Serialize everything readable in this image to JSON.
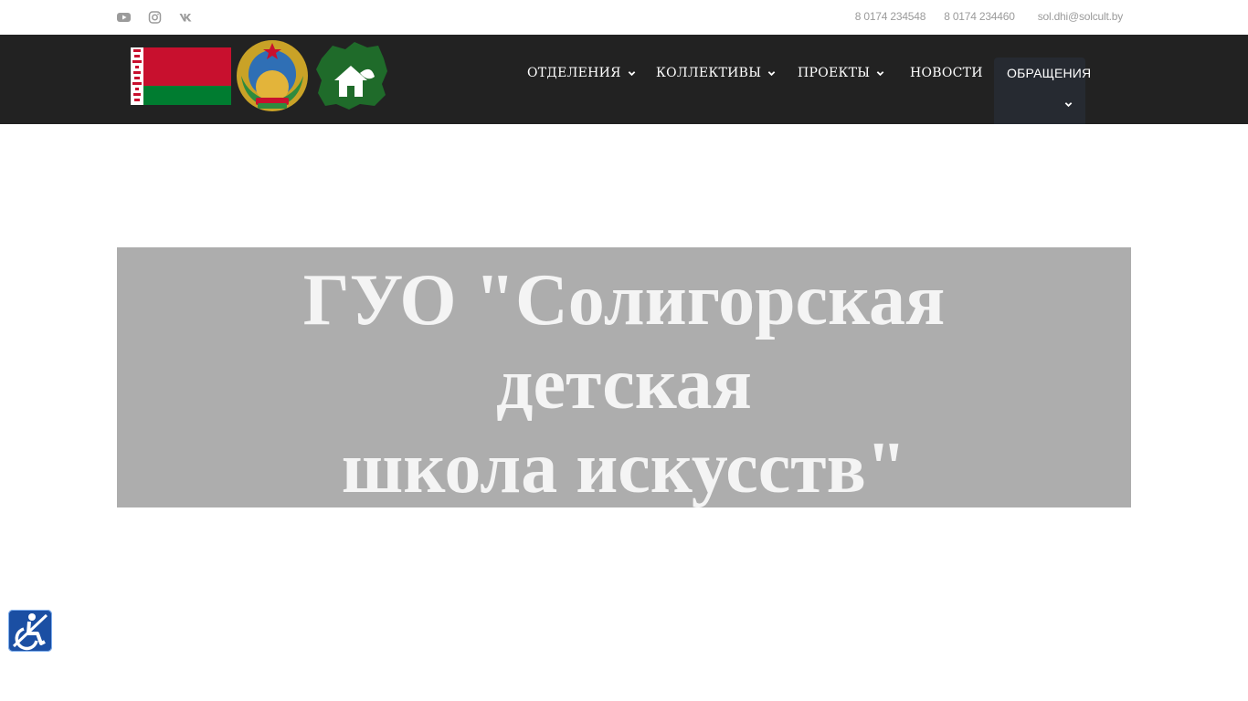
{
  "topbar": {
    "social": [
      {
        "icon": "youtube-icon"
      },
      {
        "icon": "instagram-icon"
      },
      {
        "icon": "vk-icon"
      }
    ],
    "phone1": "8 0174 234548",
    "phone2": "8 0174 234460",
    "email": "sol.dhi@solcult.by"
  },
  "nav": {
    "logos": [
      "belarus-flag-logo",
      "belarus-emblem-logo",
      "region-logo"
    ],
    "items": [
      {
        "label": "ОТДЕЛЕНИЯ",
        "has_dropdown": true
      },
      {
        "label": "КОЛЛЕКТИВЫ",
        "has_dropdown": true
      },
      {
        "label": "ПРОЕКТЫ",
        "has_dropdown": true
      },
      {
        "label": "НОВОСТИ",
        "has_dropdown": false
      },
      {
        "label": "ОБРАЩЕНИЯ",
        "has_dropdown": true
      }
    ]
  },
  "hero": {
    "title_lines": [
      "ГУО \"Солигорская",
      "детская",
      "школа искусств\""
    ]
  },
  "colors": {
    "navbar_bg": "#222222",
    "active_item_bg": "#262a31",
    "hero_bg": "#adadad",
    "hero_text": "#f4f4f4",
    "topbar_text": "#9b9b9b",
    "a11y_bg": "#1b4fa3"
  },
  "accessibility": {
    "icon": "wheelchair-icon"
  }
}
